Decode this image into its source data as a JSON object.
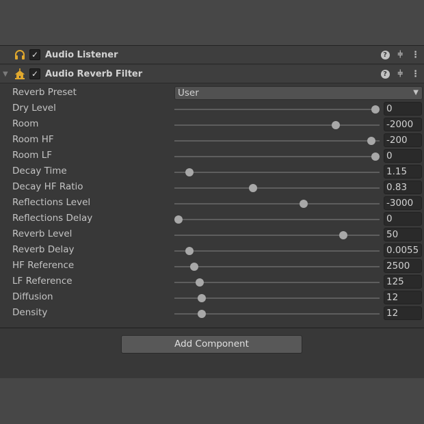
{
  "components": [
    {
      "title": "Audio Listener",
      "enabled": true,
      "icon": "headphones-icon"
    },
    {
      "title": "Audio Reverb Filter",
      "enabled": true,
      "icon": "reverb-filter-icon"
    }
  ],
  "icons": {
    "help": "?",
    "presets": "⫩",
    "menu": "⋮",
    "check": "✓",
    "fold": "▼",
    "dropdown": "▼"
  },
  "accent": "#e0a82e",
  "preset": {
    "label": "Reverb Preset",
    "value": "User"
  },
  "rows": [
    {
      "label": "Dry Level",
      "value": "0",
      "fill": 1.0
    },
    {
      "label": "Room",
      "value": "-2000",
      "fill": 0.8
    },
    {
      "label": "Room HF",
      "value": "-200",
      "fill": 0.98
    },
    {
      "label": "Room LF",
      "value": "0",
      "fill": 1.0
    },
    {
      "label": "Decay Time",
      "value": "1.15",
      "fill": 0.056
    },
    {
      "label": "Decay HF Ratio",
      "value": "0.83",
      "fill": 0.38
    },
    {
      "label": "Reflections Level",
      "value": "-3000",
      "fill": 0.635
    },
    {
      "label": "Reflections Delay",
      "value": "0",
      "fill": 0.0
    },
    {
      "label": "Reverb Level",
      "value": "50",
      "fill": 0.837
    },
    {
      "label": "Reverb Delay",
      "value": "0.0055",
      "fill": 0.056
    },
    {
      "label": "HF Reference",
      "value": "2500",
      "fill": 0.08
    },
    {
      "label": "LF Reference",
      "value": "125",
      "fill": 0.108
    },
    {
      "label": "Diffusion",
      "value": "12",
      "fill": 0.118
    },
    {
      "label": "Density",
      "value": "12",
      "fill": 0.118
    }
  ],
  "add_component": "Add Component"
}
